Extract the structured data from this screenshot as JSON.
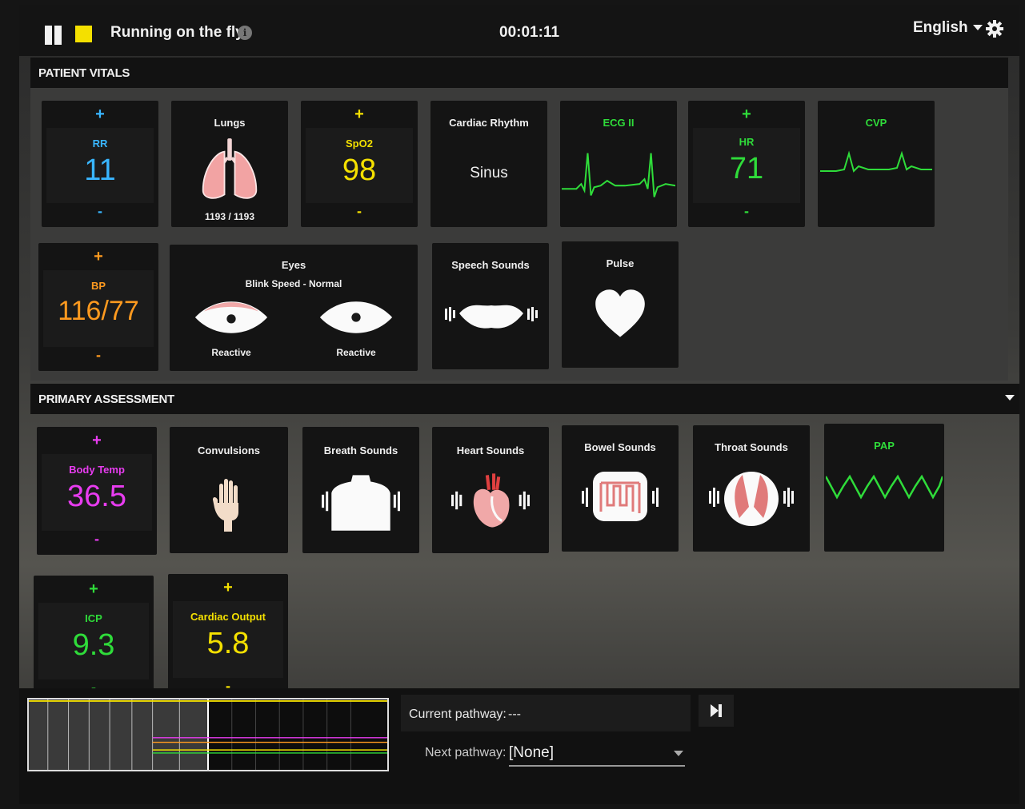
{
  "topbar": {
    "scenario_title": "Running on the fly",
    "timer": "00:01:11",
    "language": "English"
  },
  "vitals": {
    "header": "PATIENT VITALS",
    "rr": {
      "label": "RR",
      "value": "11",
      "plus": "+",
      "minus": "-",
      "color": "#39b6ff"
    },
    "lungs": {
      "label": "Lungs",
      "value": "1193 / 1193"
    },
    "spo2": {
      "label": "SpO2",
      "value": "98",
      "plus": "+",
      "minus": "-",
      "color": "#f4e000"
    },
    "cardiac_rhythm": {
      "label": "Cardiac Rhythm",
      "value": "Sinus"
    },
    "ecg": {
      "label": "ECG II",
      "color": "#2fdc3a"
    },
    "hr": {
      "label": "HR",
      "value": "71",
      "plus": "+",
      "minus": "-",
      "color": "#2fdc3a"
    },
    "cvp": {
      "label": "CVP",
      "color": "#2fdc3a"
    },
    "bp": {
      "label": "BP",
      "value": "116/77",
      "plus": "+",
      "minus": "-",
      "color": "#ff9a1f"
    },
    "eyes": {
      "label": "Eyes",
      "sub": "Blink Speed - Normal",
      "left": "Reactive",
      "right": "Reactive"
    },
    "speech": {
      "label": "Speech Sounds"
    },
    "pulse": {
      "label": "Pulse"
    }
  },
  "assessment": {
    "header": "PRIMARY ASSESSMENT",
    "body_temp": {
      "label": "Body Temp",
      "value": "36.5",
      "plus": "+",
      "minus": "-",
      "color": "#e83cf0"
    },
    "convulsions": {
      "label": "Convulsions"
    },
    "breath": {
      "label": "Breath Sounds"
    },
    "heart": {
      "label": "Heart Sounds"
    },
    "bowel": {
      "label": "Bowel Sounds"
    },
    "throat": {
      "label": "Throat Sounds"
    },
    "pap": {
      "label": "PAP",
      "color": "#2fdc3a"
    },
    "icp": {
      "label": "ICP",
      "value": "9.3",
      "plus": "+",
      "minus": "-",
      "color": "#2fdc3a"
    },
    "cardiac_output": {
      "label": "Cardiac Output",
      "value": "5.8",
      "plus": "+",
      "minus": "-",
      "color": "#f4e000"
    }
  },
  "bottom": {
    "current_label": "Current pathway:",
    "current_value": "---",
    "next_label": "Next pathway:",
    "next_value": "[None]"
  },
  "icons": [
    "pause-icon",
    "stop-icon",
    "info-icon",
    "gear-icon",
    "lungs-icon",
    "eye-icon",
    "mouth-icon",
    "heart-icon",
    "hand-icon",
    "torso-icon",
    "heart-sounds-icon",
    "bowel-icon",
    "throat-icon",
    "skip-icon"
  ]
}
